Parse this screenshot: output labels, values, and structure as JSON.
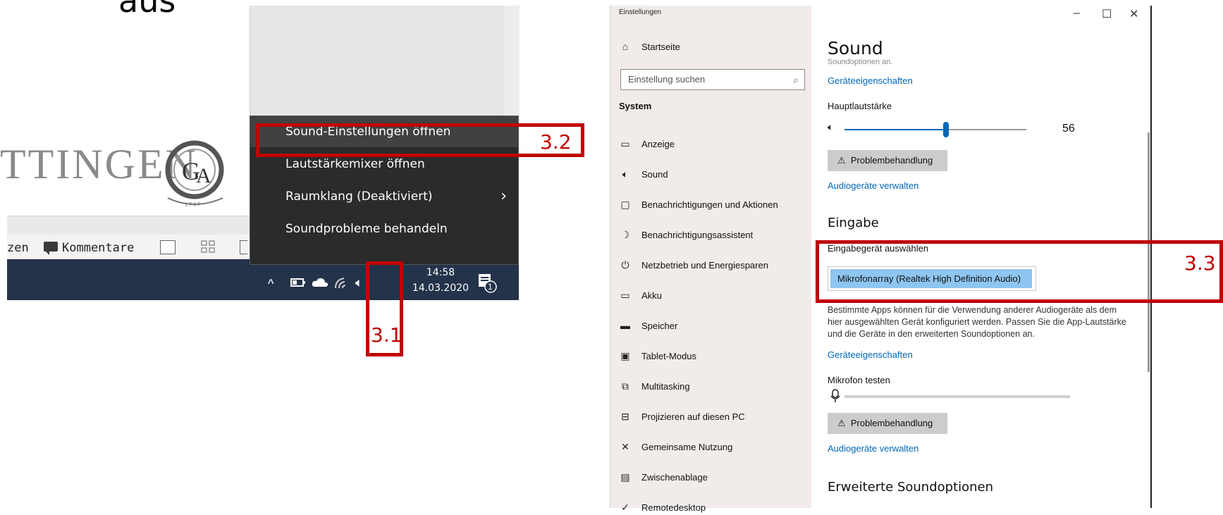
{
  "top_cut_text": "aus",
  "left_logo_text": "TTINGEN",
  "ribbon": {
    "partial_label": "zen",
    "comment_label": "Kommentare"
  },
  "context_menu": {
    "items": [
      {
        "label": "Sound-Einstellungen öffnen",
        "highlighted": true
      },
      {
        "label": "Lautstärkemixer öffnen"
      },
      {
        "label": "Raumklang (Deaktiviert)",
        "has_submenu": true
      },
      {
        "label": "Soundprobleme behandeln"
      }
    ]
  },
  "taskbar": {
    "time": "14:58",
    "date": "14.03.2020",
    "notification_count": "1"
  },
  "callouts": {
    "speaker": "3.1",
    "menu": "3.2",
    "input": "3.3"
  },
  "settings": {
    "window_title": "Einstellungen",
    "home_label": "Startseite",
    "search_placeholder": "Einstellung suchen",
    "section_label": "System",
    "nav": [
      {
        "label": "Anzeige",
        "icon": "monitor-icon"
      },
      {
        "label": "Sound",
        "icon": "speaker-icon"
      },
      {
        "label": "Benachrichtigungen und Aktionen",
        "icon": "notification-icon"
      },
      {
        "label": "Benachrichtigungsassistent",
        "icon": "moon-icon"
      },
      {
        "label": "Netzbetrieb und Energiesparen",
        "icon": "power-icon"
      },
      {
        "label": "Akku",
        "icon": "battery-icon"
      },
      {
        "label": "Speicher",
        "icon": "storage-icon"
      },
      {
        "label": "Tablet-Modus",
        "icon": "tablet-icon"
      },
      {
        "label": "Multitasking",
        "icon": "multitasking-icon"
      },
      {
        "label": "Projizieren auf diesen PC",
        "icon": "project-icon"
      },
      {
        "label": "Gemeinsame Nutzung",
        "icon": "share-icon"
      },
      {
        "label": "Zwischenablage",
        "icon": "clipboard-icon"
      },
      {
        "label": "Remotedesktop",
        "icon": "remote-icon"
      }
    ],
    "page_title": "Sound",
    "cutoff_text": "Soundoptionen an.",
    "output_device_props": "Geräteeigenschaften",
    "master_volume_label": "Hauptlautstärke",
    "master_volume_value": 56,
    "master_volume_text": "56",
    "troubleshoot_label": "Problembehandlung",
    "manage_devices": "Audiogeräte verwalten",
    "input_heading": "Eingabe",
    "input_select_label": "Eingabegerät auswählen",
    "input_selected": "Mikrofonarray (Realtek High Definition Audio)",
    "input_paragraph": "Bestimmte Apps können für die Verwendung anderer Audiogeräte als dem hier ausgewählten Gerät konfiguriert werden. Passen Sie die App-Lautstärke und die Geräte in den erweiterten Soundoptionen an.",
    "input_device_props": "Geräteeigenschaften",
    "mic_test_label": "Mikrofon testen",
    "troubleshoot_label_2": "Problembehandlung",
    "manage_devices_2": "Audiogeräte verwalten",
    "advanced_heading": "Erweiterte Soundoptionen"
  }
}
